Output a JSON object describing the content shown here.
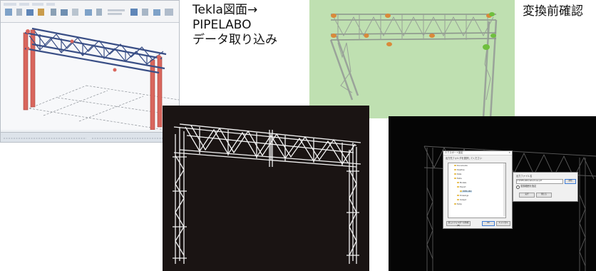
{
  "captions": {
    "tekla_line1": "Tekla図面→",
    "tekla_line2": "PIPELABO",
    "tekla_line3": "データ取り込み",
    "check": "変換前確認"
  },
  "export_dialog": {
    "title": "エクスポート設定",
    "folder_prompt": "出力先フォルダを選択してください",
    "tree_items": [
      "Documents",
      "Desktop",
      "Data",
      "Tekla",
      "Models",
      "Export",
      "PIPELABO",
      "Drawings",
      "Output",
      "Temp"
    ],
    "make_folder": "新しいフォルダーの作成(M)",
    "ok": "OK",
    "cancel": "キャンセル",
    "file_label": "出力ファイル名",
    "file_value": "C:\\PIPELABO\\data\\truss.pdf",
    "ref_button": "参照",
    "option_label": "変換範囲を指定",
    "run": "実行",
    "close": "閉じる"
  },
  "colors": {
    "steel_red": "#d9665d",
    "steel_blue": "#3a4f86",
    "check_bg": "#bfe0b1",
    "wire_bg": "#1a1413",
    "marker_orange": "#d98a3a",
    "marker_green": "#6fbf3e"
  }
}
